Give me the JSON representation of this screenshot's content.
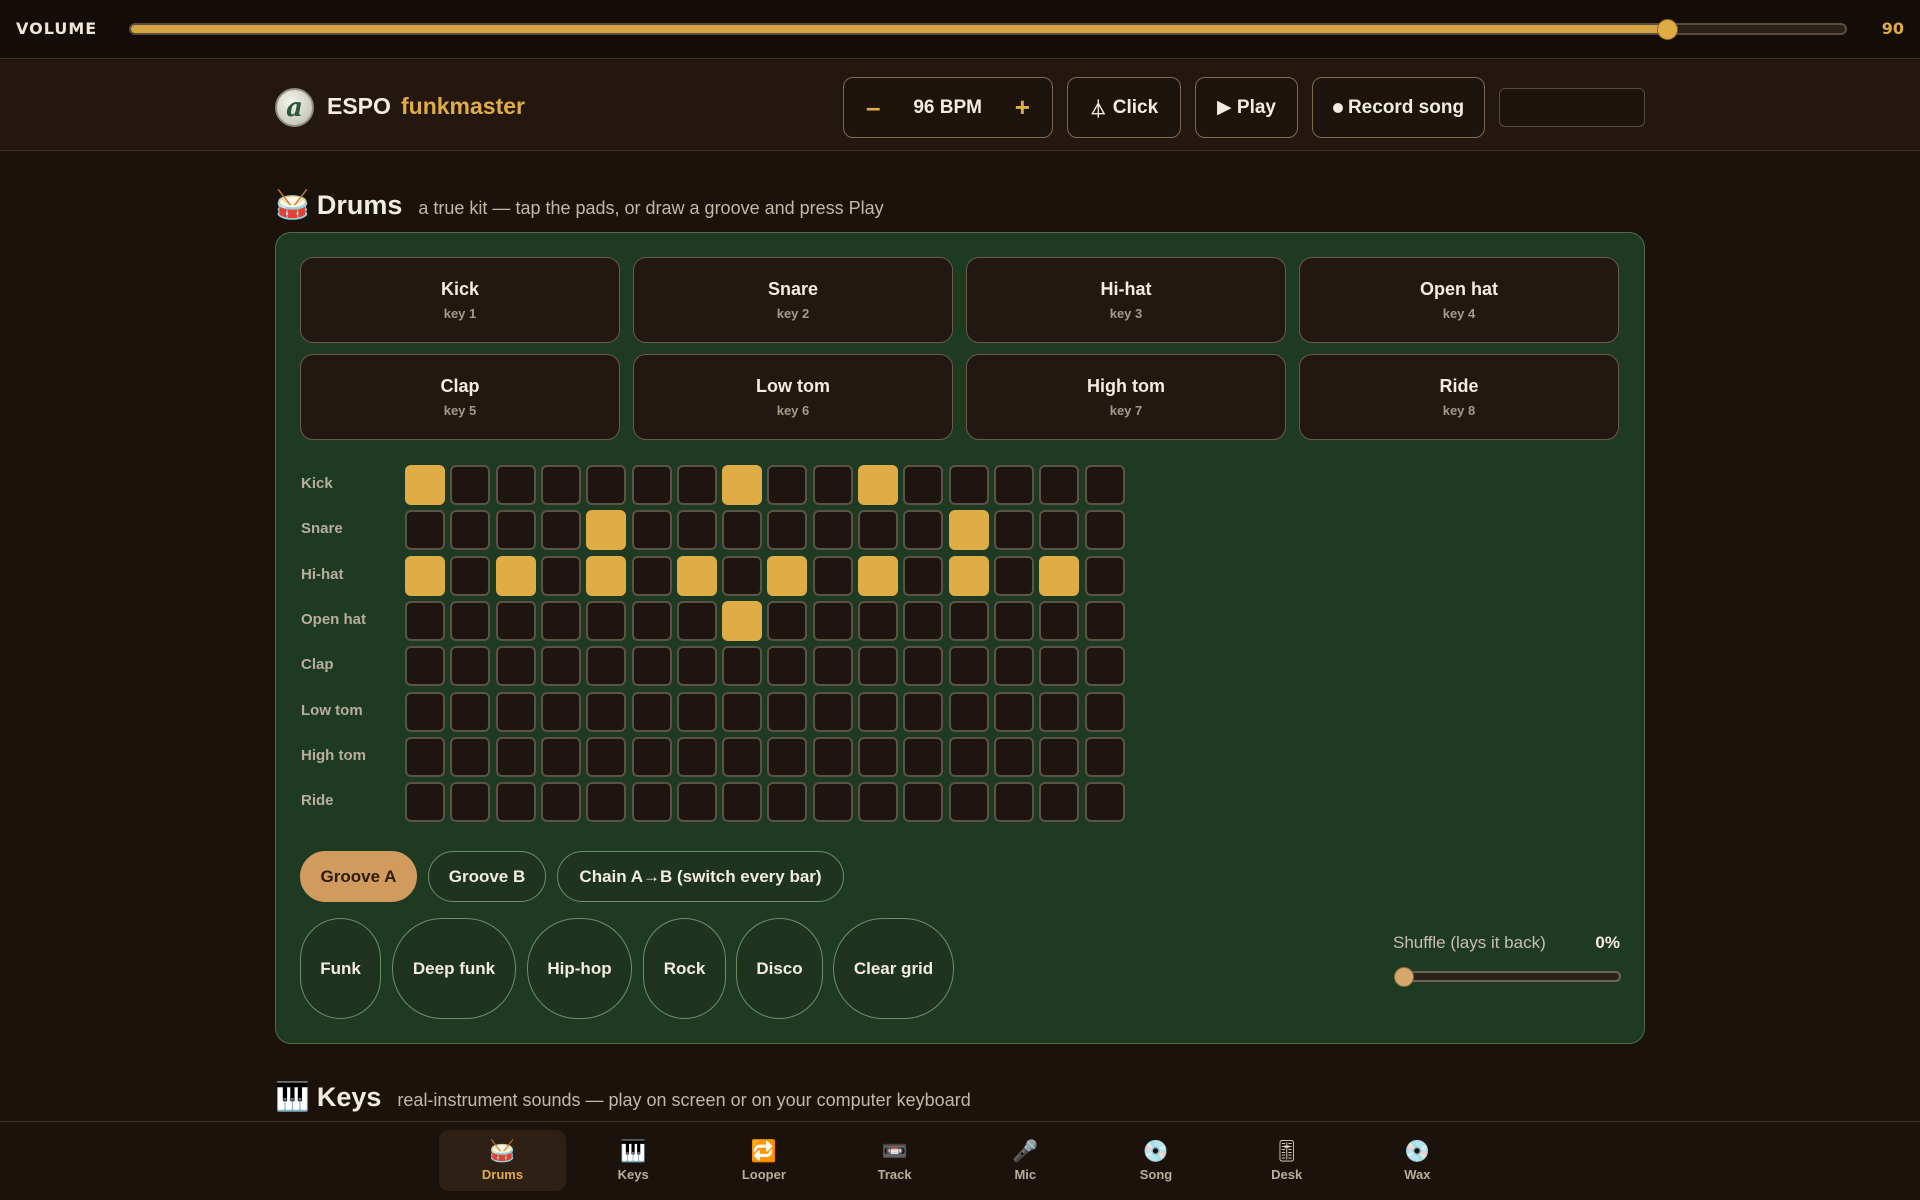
{
  "volume": {
    "label": "VOLUME",
    "value": "90",
    "level": 0.9
  },
  "header": {
    "brand": "ESPO",
    "user": "funkmaster",
    "logo_letter": "a",
    "bpm": {
      "minus": "–",
      "value": "96 BPM",
      "plus": "+"
    },
    "click_label": "Click",
    "play_label": "▶ Play",
    "record_label": "Record song",
    "search_value": ""
  },
  "drums": {
    "emoji": "🥁",
    "title": "Drums",
    "subtitle": "a true kit — tap the pads, or draw a groove and press Play",
    "pads": [
      {
        "name": "Kick",
        "key": "key 1"
      },
      {
        "name": "Snare",
        "key": "key 2"
      },
      {
        "name": "Hi-hat",
        "key": "key 3"
      },
      {
        "name": "Open hat",
        "key": "key 4"
      },
      {
        "name": "Clap",
        "key": "key 5"
      },
      {
        "name": "Low tom",
        "key": "key 6"
      },
      {
        "name": "High tom",
        "key": "key 7"
      },
      {
        "name": "Ride",
        "key": "key 8"
      }
    ],
    "rows": [
      {
        "label": "Kick",
        "steps": [
          1,
          0,
          0,
          0,
          0,
          0,
          0,
          1,
          0,
          0,
          1,
          0,
          0,
          0,
          0,
          0
        ]
      },
      {
        "label": "Snare",
        "steps": [
          0,
          0,
          0,
          0,
          1,
          0,
          0,
          0,
          0,
          0,
          0,
          0,
          1,
          0,
          0,
          0
        ]
      },
      {
        "label": "Hi-hat",
        "steps": [
          1,
          0,
          1,
          0,
          1,
          0,
          1,
          0,
          1,
          0,
          1,
          0,
          1,
          0,
          1,
          0
        ]
      },
      {
        "label": "Open hat",
        "steps": [
          0,
          0,
          0,
          0,
          0,
          0,
          0,
          1,
          0,
          0,
          0,
          0,
          0,
          0,
          0,
          0
        ]
      },
      {
        "label": "Clap",
        "steps": [
          0,
          0,
          0,
          0,
          0,
          0,
          0,
          0,
          0,
          0,
          0,
          0,
          0,
          0,
          0,
          0
        ]
      },
      {
        "label": "Low tom",
        "steps": [
          0,
          0,
          0,
          0,
          0,
          0,
          0,
          0,
          0,
          0,
          0,
          0,
          0,
          0,
          0,
          0
        ]
      },
      {
        "label": "High tom",
        "steps": [
          0,
          0,
          0,
          0,
          0,
          0,
          0,
          0,
          0,
          0,
          0,
          0,
          0,
          0,
          0,
          0
        ]
      },
      {
        "label": "Ride",
        "steps": [
          0,
          0,
          0,
          0,
          0,
          0,
          0,
          0,
          0,
          0,
          0,
          0,
          0,
          0,
          0,
          0
        ]
      }
    ],
    "grooves": [
      {
        "label": "Groove A",
        "active": true
      },
      {
        "label": "Groove B",
        "active": false
      },
      {
        "label": "Chain A→B (switch every bar)",
        "active": false
      }
    ],
    "presets": [
      "Funk",
      "Deep funk",
      "Hip-hop",
      "Rock",
      "Disco",
      "Clear grid"
    ],
    "shuffle": {
      "label": "Shuffle (lays it back)",
      "value": "0%",
      "level": 0
    }
  },
  "keys": {
    "emoji": "🎹",
    "title": "Keys",
    "subtitle": "real-instrument sounds — play on screen or on your computer keyboard"
  },
  "nav": [
    {
      "icon": "🥁",
      "label": "Drums",
      "active": true
    },
    {
      "icon": "🎹",
      "label": "Keys",
      "active": false
    },
    {
      "icon": "🔁",
      "label": "Looper",
      "active": false
    },
    {
      "icon": "📼",
      "label": "Track",
      "active": false
    },
    {
      "icon": "🎤",
      "label": "Mic",
      "active": false
    },
    {
      "icon": "💿",
      "label": "Song",
      "active": false
    },
    {
      "icon": "🎚",
      "label": "Desk",
      "active": false
    },
    {
      "icon": "💿",
      "label": "Wax",
      "active": false
    }
  ],
  "colors": {
    "accent": "#e0ac46",
    "panel": "#1f3a22",
    "background": "#1b120c"
  }
}
